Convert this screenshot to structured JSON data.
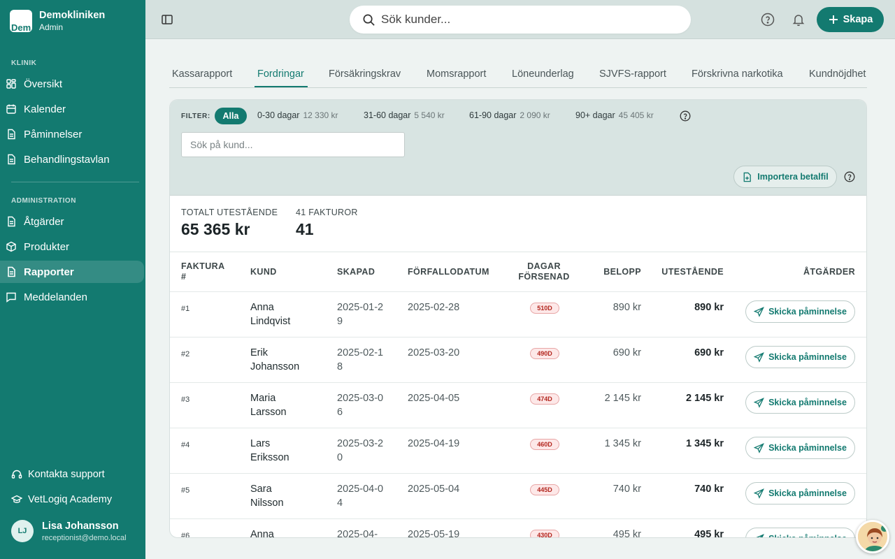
{
  "brand": {
    "name": "Demokliniken",
    "role": "Admin",
    "logo_text": "Dem"
  },
  "sidebar": {
    "section_klinik": "KLINIK",
    "klinik_items": [
      {
        "label": "Översikt",
        "icon": "grid-icon"
      },
      {
        "label": "Kalender",
        "icon": "calendar-icon"
      },
      {
        "label": "Påminnelser",
        "icon": "document-icon"
      },
      {
        "label": "Behandlingstavlan",
        "icon": "document-icon"
      }
    ],
    "section_admin": "ADMINISTRATION",
    "admin_items": [
      {
        "label": "Åtgärder",
        "icon": "document-icon"
      },
      {
        "label": "Produkter",
        "icon": "box-icon"
      },
      {
        "label": "Rapporter",
        "icon": "document-icon",
        "active": true
      },
      {
        "label": "Meddelanden",
        "icon": "message-icon"
      }
    ],
    "support": "Kontakta support",
    "academy": "VetLogiq Academy",
    "user": {
      "initials": "LJ",
      "name": "Lisa Johansson",
      "email": "receptionist@demo.local"
    }
  },
  "header": {
    "search_placeholder": "Sök kunder...",
    "create_label": "Skapa"
  },
  "tabs": [
    "Kassarapport",
    "Fordringar",
    "Försäkringskrav",
    "Momsrapport",
    "Löneunderlag",
    "SJVFS-rapport",
    "Förskrivna narkotika",
    "Kundnöjdhet"
  ],
  "active_tab": "Fordringar",
  "filter": {
    "label": "FILTER:",
    "all": "Alla",
    "chips": [
      {
        "label": "0-30 dagar",
        "amount": "12 330 kr"
      },
      {
        "label": "31-60 dagar",
        "amount": "5 540 kr"
      },
      {
        "label": "61-90 dagar",
        "amount": "2 090 kr"
      },
      {
        "label": "90+ dagar",
        "amount": "45 405 kr"
      }
    ],
    "search_placeholder": "Sök på kund...",
    "import_label": "Importera betalfil"
  },
  "summary": {
    "total_label": "TOTALT UTESTÅENDE",
    "total_value": "65 365 kr",
    "count_label": "41 FAKTUROR",
    "count_value": "41"
  },
  "table": {
    "headers": {
      "invoice": "FAKTURA #",
      "customer": "KUND",
      "created": "SKAPAD",
      "due": "FÖRFALLODATUM",
      "days_late": "DAGAR FÖRSENAD",
      "amount": "BELOPP",
      "outstanding": "UTESTÅENDE",
      "actions": "ÅTGÄRDER"
    },
    "action_label": "Skicka påminnelse",
    "rows": [
      {
        "invoice": "#1",
        "customer": "Anna Lindqvist",
        "created": "2025-01-29",
        "due": "2025-02-28",
        "days": "510D",
        "amount": "890 kr",
        "outstanding": "890 kr"
      },
      {
        "invoice": "#2",
        "customer": "Erik Johansson",
        "created": "2025-02-18",
        "due": "2025-03-20",
        "days": "490D",
        "amount": "690 kr",
        "outstanding": "690 kr"
      },
      {
        "invoice": "#3",
        "customer": "Maria Larsson",
        "created": "2025-03-06",
        "due": "2025-04-05",
        "days": "474D",
        "amount": "2 145 kr",
        "outstanding": "2 145 kr"
      },
      {
        "invoice": "#4",
        "customer": "Lars Eriksson",
        "created": "2025-03-20",
        "due": "2025-04-19",
        "days": "460D",
        "amount": "1 345 kr",
        "outstanding": "1 345 kr"
      },
      {
        "invoice": "#5",
        "customer": "Sara Nilsson",
        "created": "2025-04-04",
        "due": "2025-05-04",
        "days": "445D",
        "amount": "740 kr",
        "outstanding": "740 kr"
      },
      {
        "invoice": "#6",
        "customer": "Anna",
        "created": "2025-04-",
        "due": "2025-05-19",
        "days": "430D",
        "amount": "495 kr",
        "outstanding": "495 kr"
      }
    ]
  }
}
